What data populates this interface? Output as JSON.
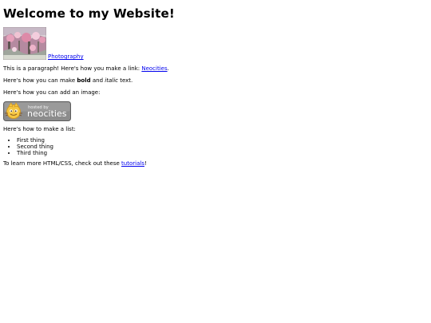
{
  "heading": "Welcome to my Website!",
  "photo": {
    "link_label": "Photography"
  },
  "paragraph_link": {
    "before": "This is a paragraph! Here's how you make a link: ",
    "link_label": "Neocities",
    "after": "."
  },
  "formatting": {
    "before": "Here's how you can make ",
    "bold": "bold",
    "middle": " and ",
    "italic": "italic",
    "after": " text."
  },
  "image_intro": "Here's how you can add an image:",
  "badge": {
    "small_text": "hosted by",
    "big_text": "neocities"
  },
  "list_intro": "Here's how to make a list:",
  "list_items": [
    "First thing",
    "Second thing",
    "Third thing"
  ],
  "tutorials": {
    "before": "To learn more HTML/CSS, check out these ",
    "link_label": "tutorials",
    "after": "!"
  }
}
